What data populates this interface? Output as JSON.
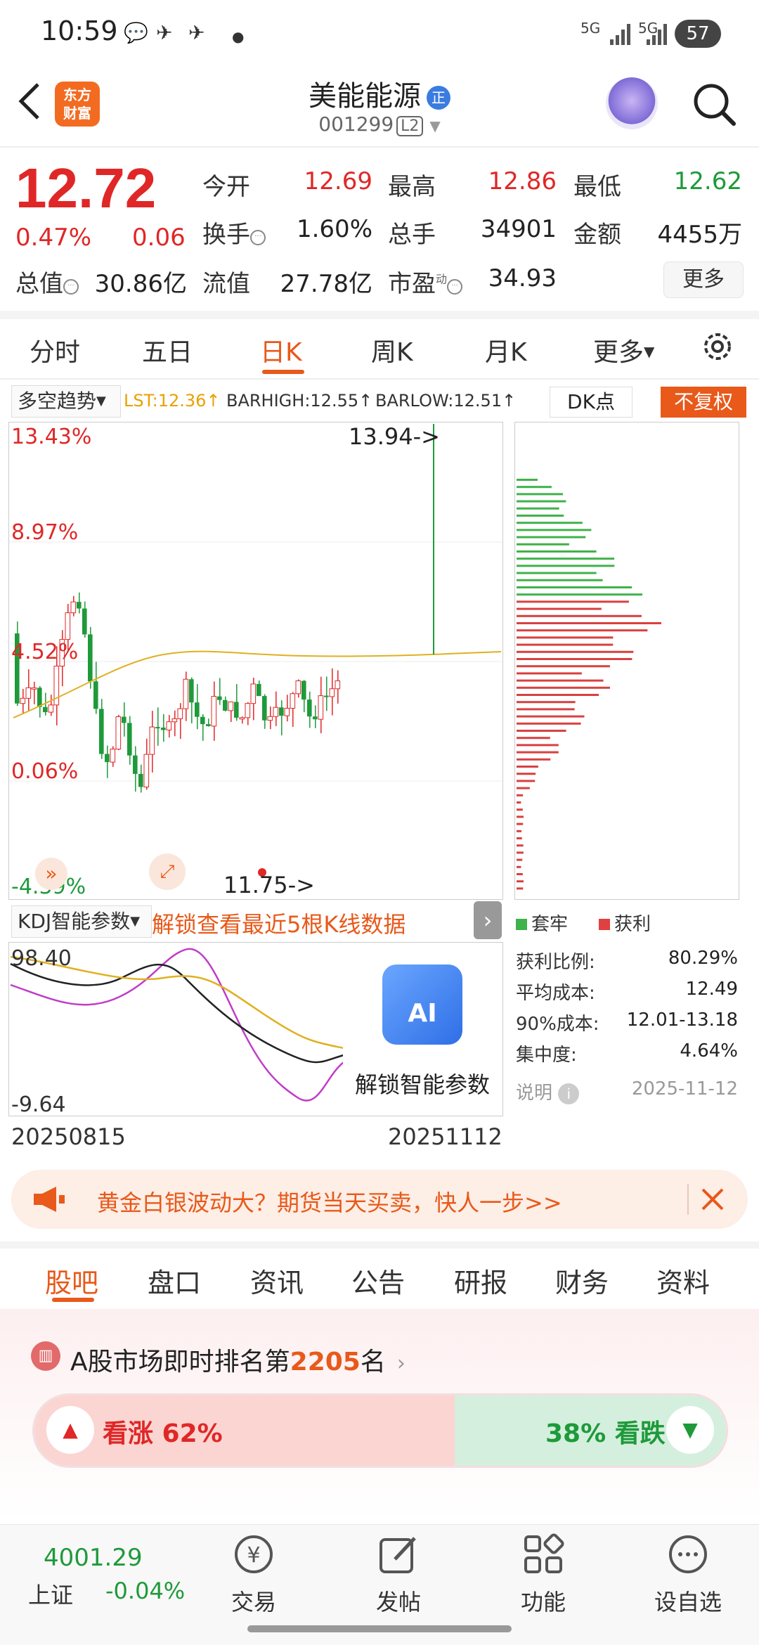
{
  "status_bar": {
    "time": "10:59",
    "net1": "5G",
    "net2": "5G",
    "battery": "57"
  },
  "header": {
    "logo_line1": "东方",
    "logo_line2": "财富",
    "stock_name": "美能能源",
    "name_badge": "正",
    "stock_code": "001299",
    "level": "L2"
  },
  "quote": {
    "price": "12.72",
    "change_pct": "0.47%",
    "change_abs": "0.06",
    "open_label": "今开",
    "open": "12.69",
    "high_label": "最高",
    "high": "12.86",
    "low_label": "最低",
    "low": "12.62",
    "turnover_label": "换手",
    "turnover": "1.60%",
    "volume_label": "总手",
    "volume": "34901",
    "amount_label": "金额",
    "amount": "4455万",
    "mcap_label": "总值",
    "mcap": "30.86亿",
    "float_label": "流值",
    "float_mcap": "27.78亿",
    "pe_label": "市盈",
    "pe_sup": "动",
    "pe": "34.93",
    "more": "更多"
  },
  "tabs": [
    "分时",
    "五日",
    "日K",
    "周K",
    "月K",
    "更多"
  ],
  "active_tab": "日K",
  "chart_toolbar": {
    "indicator": "多空趋势",
    "lst": "LST:12.36↑",
    "barhigh": "BARHIGH:12.55↑",
    "barlow": "BARLOW:12.51↑",
    "dk": "DK点",
    "adjust": "不复权"
  },
  "kline_labels": {
    "y1": "13.43%",
    "y2": "8.97%",
    "y3": "4.52%",
    "y4": "0.06%",
    "y5": "-4.39%",
    "max_mark": "13.94->",
    "min_mark": "11.75->"
  },
  "kdj": {
    "select": "KDJ智能参数",
    "unlock_text": "解锁查看最近5根K线数据",
    "top": "98.40",
    "bottom": "-9.64",
    "ai_label": "AI",
    "ai_text": "解锁智能参数"
  },
  "dates": {
    "start": "20250815",
    "end": "20251112"
  },
  "chips": {
    "legend_loss": "套牢",
    "legend_profit": "获利",
    "profit_ratio_label": "获利比例:",
    "profit_ratio": "80.29%",
    "avg_cost_label": "平均成本:",
    "avg_cost": "12.49",
    "cost90_label": "90%成本:",
    "cost90": "12.01-13.18",
    "concentration_label": "集中度:",
    "concentration": "4.64%",
    "note_label": "说明",
    "date": "2025-11-12"
  },
  "banner": {
    "text": "黄金白银波动大？期货当天买卖，快人一步>>"
  },
  "bottom_tabs": [
    "股吧",
    "盘口",
    "资讯",
    "公告",
    "研报",
    "财务",
    "资料"
  ],
  "ranking": {
    "prefix": "A股市场即时排名第",
    "rank": "2205",
    "suffix": "名"
  },
  "vote": {
    "up": "看涨 62%",
    "down": "38% 看跌",
    "up_pct": 62
  },
  "nav": {
    "index_value": "4001.29",
    "index_name": "上证",
    "index_change": "-0.04%",
    "trade": "交易",
    "post": "发帖",
    "func": "功能",
    "watch": "设自选"
  },
  "colors": {
    "up": "#e02727",
    "down": "#1e9a3a",
    "accent": "#e8591a"
  }
}
